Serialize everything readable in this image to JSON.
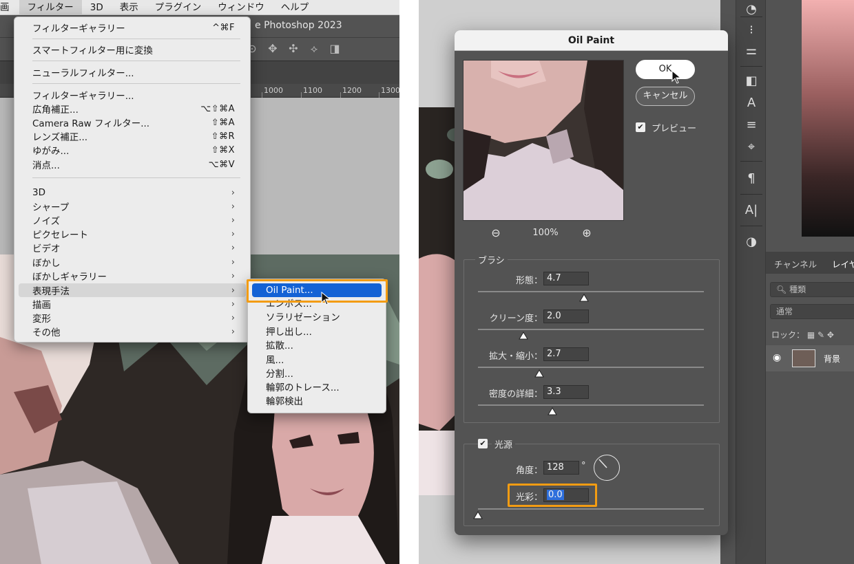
{
  "menubar": {
    "items": [
      "画",
      "フィルター",
      "3D",
      "表示",
      "プラグイン",
      "ウィンドウ",
      "ヘルプ"
    ],
    "active_index": 1
  },
  "window_title": "e Photoshop 2023",
  "ruler_ticks": [
    "1000",
    "1100",
    "1200",
    "1300"
  ],
  "filter_menu": {
    "items": [
      {
        "label": "フィルターギャラリー",
        "shortcut": "^⌘F"
      },
      {
        "label": "スマートフィルター用に変換",
        "shortcut": ""
      },
      {
        "label": "ニューラルフィルター...",
        "shortcut": ""
      },
      {
        "label": "フィルターギャラリー...",
        "shortcut": ""
      },
      {
        "label": "広角補正...",
        "shortcut": "⌥⇧⌘A"
      },
      {
        "label": "Camera Raw フィルター...",
        "shortcut": "⇧⌘A"
      },
      {
        "label": "レンズ補正...",
        "shortcut": "⇧⌘R"
      },
      {
        "label": "ゆがみ...",
        "shortcut": "⇧⌘X"
      },
      {
        "label": "消点...",
        "shortcut": "⌥⌘V"
      },
      {
        "label": "3D",
        "shortcut": "›"
      },
      {
        "label": "シャープ",
        "shortcut": "›"
      },
      {
        "label": "ノイズ",
        "shortcut": "›"
      },
      {
        "label": "ピクセレート",
        "shortcut": "›"
      },
      {
        "label": "ビデオ",
        "shortcut": "›"
      },
      {
        "label": "ぼかし",
        "shortcut": "›"
      },
      {
        "label": "ぼかしギャラリー",
        "shortcut": "›"
      },
      {
        "label": "表現手法",
        "shortcut": "›"
      },
      {
        "label": "描画",
        "shortcut": "›"
      },
      {
        "label": "変形",
        "shortcut": "›"
      },
      {
        "label": "その他",
        "shortcut": "›"
      }
    ]
  },
  "submenu": {
    "items": [
      "Oil Paint...",
      "エンボス...",
      "ソラリゼーション",
      "押し出し...",
      "拡散...",
      "風...",
      "分割...",
      "輪郭のトレース...",
      "輪郭検出"
    ],
    "selected_index": 0
  },
  "dialog": {
    "title": "Oil Paint",
    "ok_label": "OK",
    "cancel_label": "キャンセル",
    "preview_label": "プレビュー",
    "zoom_level": "100%",
    "brush_group": "ブラシ",
    "brush_rows": [
      {
        "label": "形態：",
        "value": "4.7",
        "slider_fraction": 0.47
      },
      {
        "label": "クリーン度：",
        "value": "2.0",
        "slider_fraction": 0.2
      },
      {
        "label": "拡大・縮小：",
        "value": "2.7",
        "slider_fraction": 0.27
      },
      {
        "label": "密度の詳細：",
        "value": "3.3",
        "slider_fraction": 0.33
      }
    ],
    "light_group": "光源",
    "angle_label": "角度：",
    "angle_value": "128",
    "angle_unit": "°",
    "shine_label": "光彩：",
    "shine_value": "0.0",
    "shine_fraction": 0
  },
  "layers": {
    "tabs": [
      "チャンネル",
      "レイヤ"
    ],
    "search_placeholder": "種類",
    "blend_mode": "通常",
    "lock_label": "ロック：",
    "layer_name": "背景"
  },
  "colors": {
    "accent_highlight": "#f39c12",
    "menu_selection": "#1362d5"
  }
}
